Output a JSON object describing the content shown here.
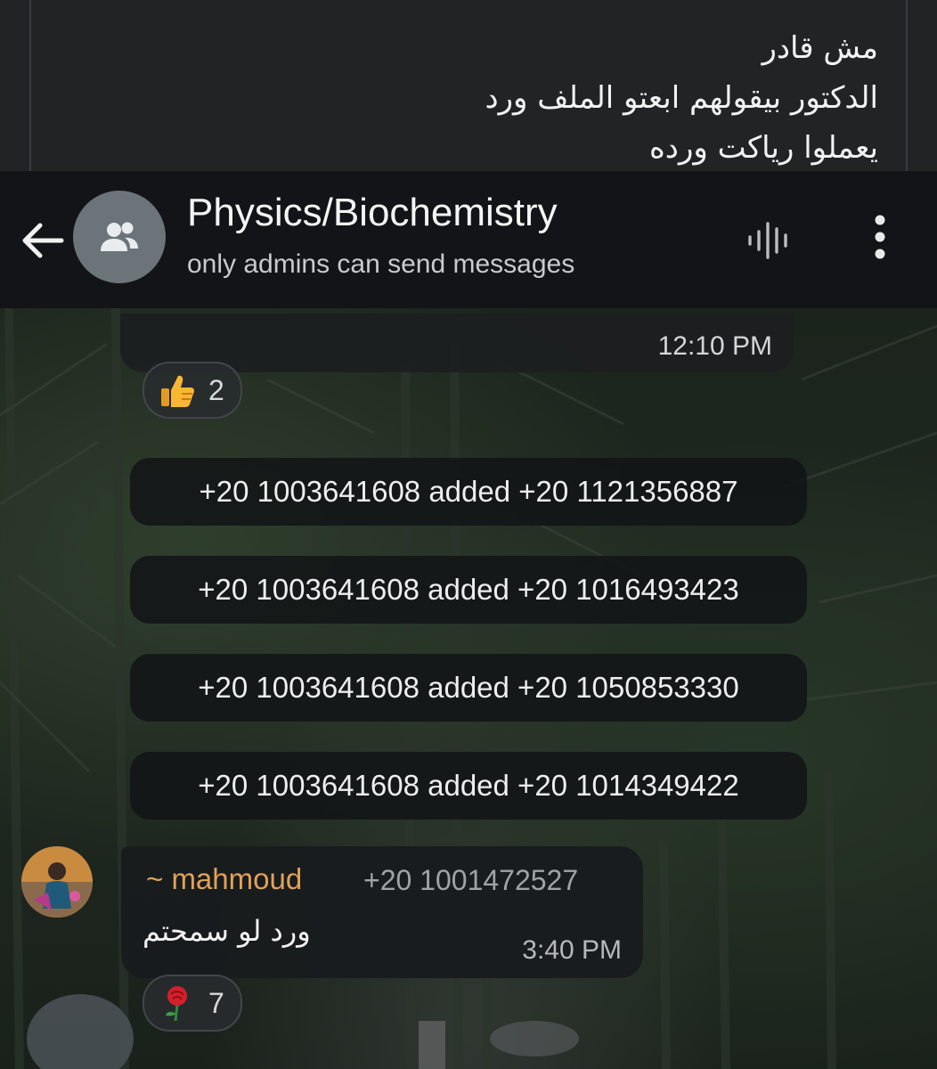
{
  "caption": {
    "lines": [
      "مش قادر",
      "الدكتور بيقولهم ابعتو الملف ورد",
      "يعملوا رياكت ورده"
    ]
  },
  "header": {
    "title": "Physics/Biochemistry",
    "subtitle": "only admins can send messages",
    "icons": {
      "back": "arrow-left-icon",
      "avatar": "group-icon",
      "voice": "voice-chat-icon",
      "menu": "more-vertical-icon"
    }
  },
  "messages": {
    "prev_time": "12:10 PM",
    "prev_reaction": {
      "emoji": "thumbs-up-icon",
      "count": "2"
    },
    "service": [
      "+20 1003641608 added +20 1121356887",
      "+20 1003641608 added +20 1016493423",
      "+20 1003641608 added +20 1050853330",
      "+20 1003641608 added +20 1014349422"
    ],
    "last": {
      "sender": "~ mahmoud",
      "phone": "+20 1001472527",
      "text": "ورد لو سمحتم",
      "time": "3:40 PM",
      "reaction": {
        "emoji": "rose-icon",
        "count": "7"
      }
    }
  },
  "colors": {
    "header_bg": "#121417",
    "caption_bg": "#222325",
    "sender_name": "#e0a15a",
    "bubble_bg": "#181b1e"
  }
}
